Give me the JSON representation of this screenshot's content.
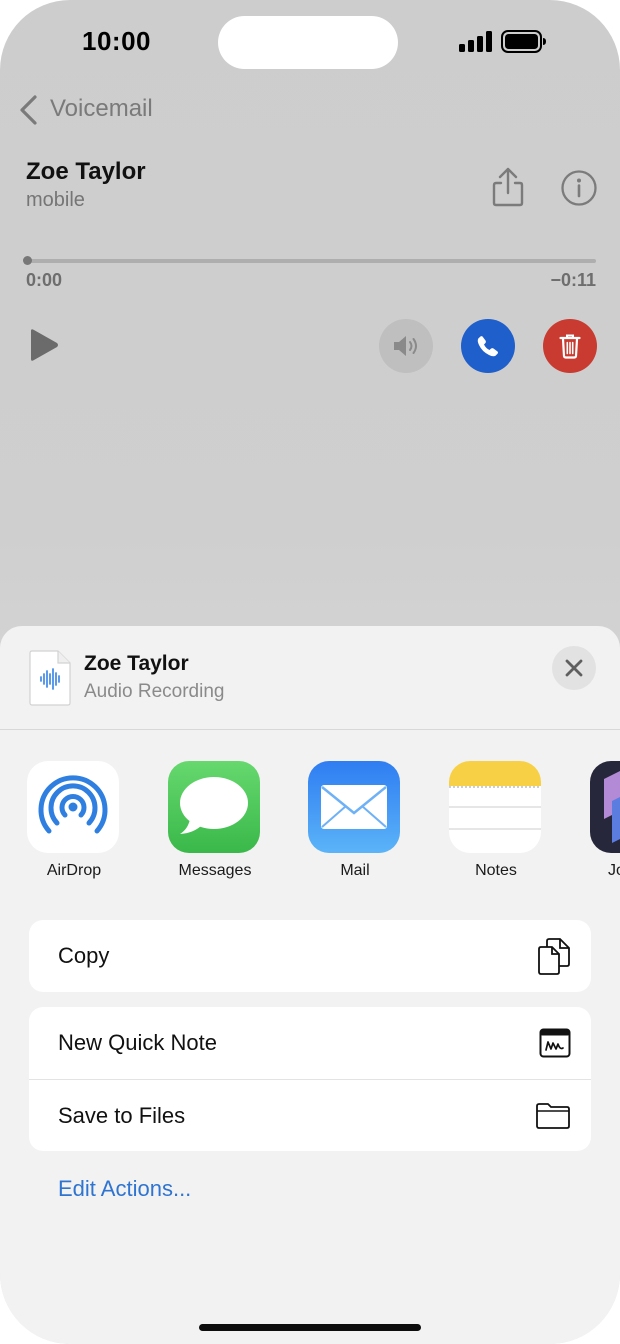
{
  "status_bar": {
    "time": "10:00"
  },
  "voicemail": {
    "back_label": "Voicemail",
    "contact_name": "Zoe Taylor",
    "contact_type": "mobile",
    "elapsed": "0:00",
    "remaining": "−0:11",
    "playback_progress": 0
  },
  "share_sheet": {
    "file_name": "Zoe Taylor",
    "file_type": "Audio Recording",
    "apps": [
      {
        "label": "AirDrop",
        "icon": "airdrop-icon"
      },
      {
        "label": "Messages",
        "icon": "messages-icon"
      },
      {
        "label": "Mail",
        "icon": "mail-icon"
      },
      {
        "label": "Notes",
        "icon": "notes-icon"
      },
      {
        "label": "Jo",
        "icon": "app-icon-partial"
      }
    ],
    "actions": [
      {
        "label": "Copy",
        "icon": "copy-icon"
      },
      {
        "label": "New Quick Note",
        "icon": "quick-note-icon"
      },
      {
        "label": "Save to Files",
        "icon": "folder-icon"
      }
    ],
    "edit_actions_label": "Edit Actions..."
  },
  "colors": {
    "call": "#1f5fcc",
    "delete": "#c93a30",
    "link": "#2f74d0",
    "airdrop": "#2f7fe0",
    "messages": "#4fcd5a",
    "mail": "#3c8cf5",
    "notes_top": "#f7d046"
  }
}
